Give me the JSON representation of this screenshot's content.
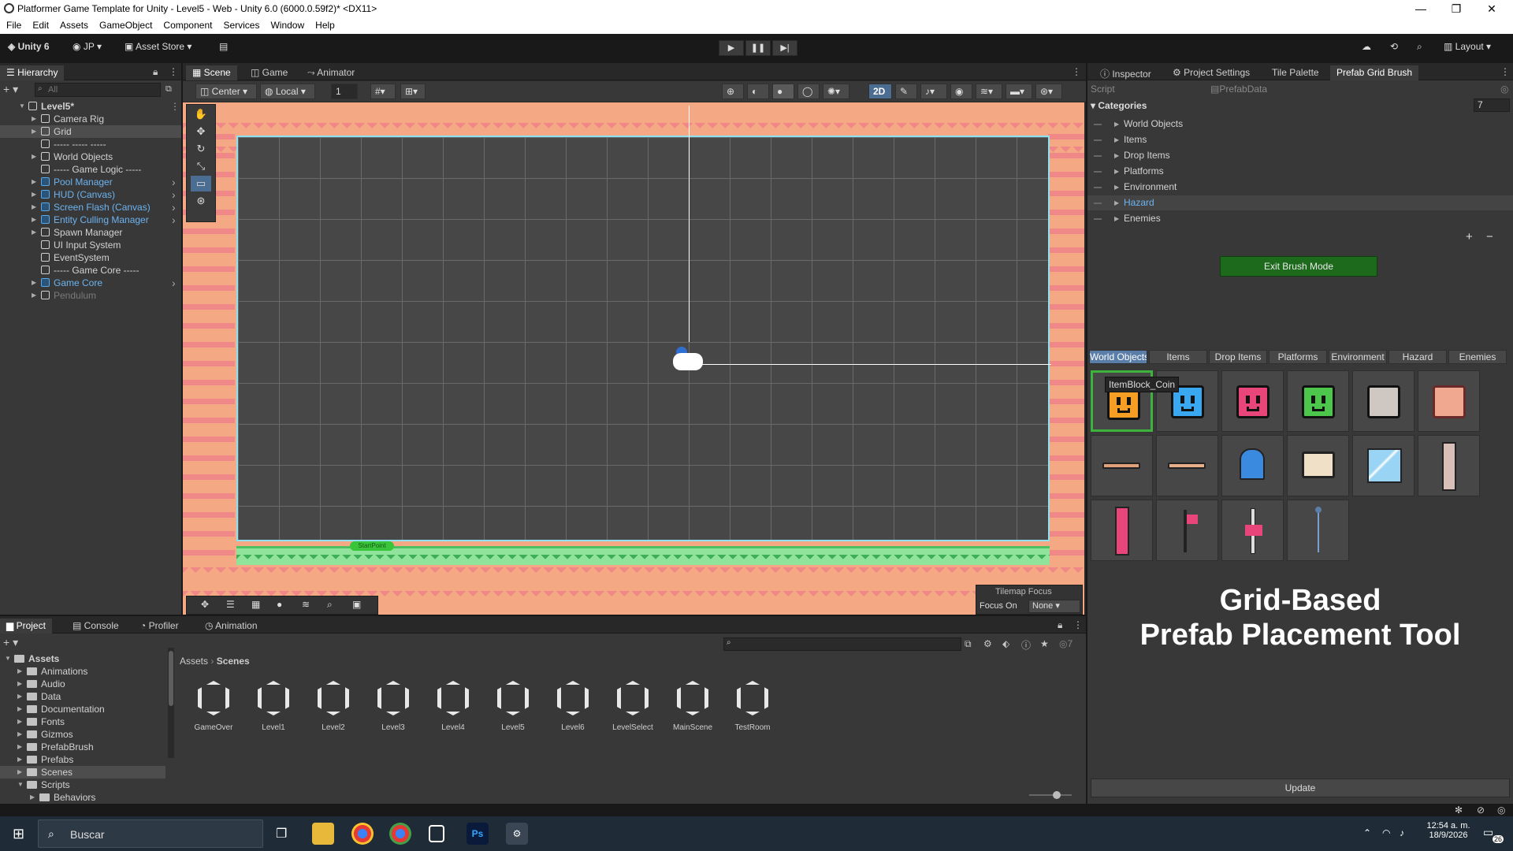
{
  "window": {
    "title": "Platformer Game Template for Unity - Level5 - Web - Unity 6.0 (6000.0.59f2)* <DX11>",
    "minimize": "—",
    "maximize": "❐",
    "close": "✕"
  },
  "menu": [
    "File",
    "Edit",
    "Assets",
    "GameObject",
    "Component",
    "Services",
    "Window",
    "Help"
  ],
  "toolbar": {
    "logo": "Unity 6",
    "account": "JP",
    "asset_store": "Asset Store",
    "layout": "Layout",
    "play_icon": "▶",
    "pause_icon": "❚❚",
    "step_icon": "▶|"
  },
  "hierarchy": {
    "tab": "Hierarchy",
    "search_placeholder": "All",
    "add": "+",
    "rows": [
      {
        "label": "Level5*",
        "indent": 0,
        "kind": "scene"
      },
      {
        "label": "Camera Rig",
        "indent": 1,
        "kind": "go"
      },
      {
        "label": "Grid",
        "indent": 1,
        "kind": "go",
        "selected": true
      },
      {
        "label": "----- ----- -----",
        "indent": 1,
        "kind": "go"
      },
      {
        "label": "World Objects",
        "indent": 1,
        "kind": "go"
      },
      {
        "label": "----- Game Logic -----",
        "indent": 1,
        "kind": "go"
      },
      {
        "label": "Pool Manager",
        "indent": 1,
        "kind": "prefab"
      },
      {
        "label": "HUD (Canvas)",
        "indent": 1,
        "kind": "prefab"
      },
      {
        "label": "Screen Flash (Canvas)",
        "indent": 1,
        "kind": "prefab"
      },
      {
        "label": "Entity Culling Manager",
        "indent": 1,
        "kind": "prefab"
      },
      {
        "label": "Spawn Manager",
        "indent": 1,
        "kind": "go"
      },
      {
        "label": "UI Input System",
        "indent": 1,
        "kind": "go"
      },
      {
        "label": "EventSystem",
        "indent": 1,
        "kind": "go"
      },
      {
        "label": "----- Game Core -----",
        "indent": 1,
        "kind": "go"
      },
      {
        "label": "Game Core",
        "indent": 1,
        "kind": "prefab"
      },
      {
        "label": "Pendulum",
        "indent": 1,
        "kind": "disabled"
      }
    ]
  },
  "scene": {
    "tabs": [
      "Scene",
      "Game",
      "Animator"
    ],
    "pivot": "Center",
    "space": "Local",
    "snap_value": "1",
    "mode_2d": "2D",
    "start_label": "StartPoint",
    "tilemap_focus": "Tilemap Focus",
    "focus_on": "Focus On",
    "focus_value": "None"
  },
  "inspector": {
    "tabs": [
      "Inspector",
      "Project Settings",
      "Tile Palette",
      "Prefab Grid Brush"
    ],
    "script_label": "Script",
    "script_value": "PrefabData",
    "categories_label": "Categories",
    "categories_count": "7",
    "categories": [
      "World Objects",
      "Items",
      "Drop Items",
      "Platforms",
      "Environment",
      "Hazard",
      "Enemies"
    ],
    "selected_category": "Hazard",
    "exit_button": "Exit Brush Mode",
    "palette_tabs": [
      "World Objects",
      "Items",
      "Drop Items",
      "Platforms",
      "Environment",
      "Hazard",
      "Enemies"
    ],
    "active_palette_tab": "World Objects",
    "tooltip": "ItemBlock_Coin",
    "update_button": "Update",
    "heading_line1": "Grid-Based",
    "heading_line2": "Prefab Placement Tool",
    "colors": {
      "orange": "#f59e23",
      "blue": "#3aa8f0",
      "pink": "#e8457a",
      "green": "#4cc74c",
      "gray": "#cfc8c2"
    }
  },
  "project": {
    "tabs": [
      "Project",
      "Console",
      "Profiler",
      "Animation"
    ],
    "tree": [
      {
        "label": "Assets",
        "indent": 0,
        "bold": true
      },
      {
        "label": "Animations",
        "indent": 1
      },
      {
        "label": "Audio",
        "indent": 1
      },
      {
        "label": "Data",
        "indent": 1
      },
      {
        "label": "Documentation",
        "indent": 1
      },
      {
        "label": "Fonts",
        "indent": 1
      },
      {
        "label": "Gizmos",
        "indent": 1
      },
      {
        "label": "PrefabBrush",
        "indent": 1
      },
      {
        "label": "Prefabs",
        "indent": 1
      },
      {
        "label": "Scenes",
        "indent": 1,
        "selected": true
      },
      {
        "label": "Scripts",
        "indent": 1
      },
      {
        "label": "Behaviors",
        "indent": 2
      }
    ],
    "breadcrumb": [
      "Assets",
      "Scenes"
    ],
    "hidden_count": "7",
    "scenes": [
      "GameOver",
      "Level1",
      "Level2",
      "Level3",
      "Level4",
      "Level5",
      "Level6",
      "LevelSelect",
      "MainScene",
      "TestRoom"
    ]
  },
  "taskbar": {
    "search_placeholder": "Buscar",
    "time": "12:54 a. m.",
    "date": "18/9/2026",
    "notifications": "26"
  }
}
